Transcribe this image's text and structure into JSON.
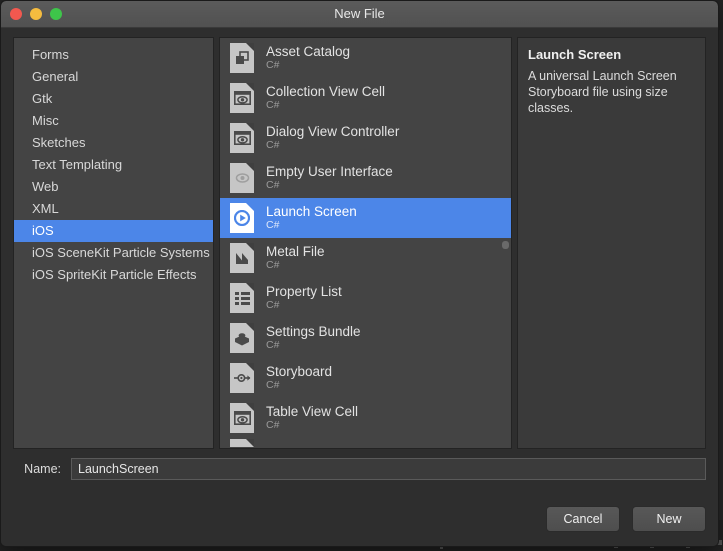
{
  "window": {
    "title": "New File",
    "traffic_lights": [
      {
        "name": "close-button",
        "color": "#f2584f"
      },
      {
        "name": "minimize-button",
        "color": "#f5bc3f"
      },
      {
        "name": "maximize-button",
        "color": "#3ec54a"
      }
    ]
  },
  "categories": {
    "selected": "iOS",
    "items": [
      {
        "label": "Forms",
        "selected": false
      },
      {
        "label": "General",
        "selected": false
      },
      {
        "label": "Gtk",
        "selected": false
      },
      {
        "label": "Misc",
        "selected": false
      },
      {
        "label": "Sketches",
        "selected": false
      },
      {
        "label": "Text Templating",
        "selected": false
      },
      {
        "label": "Web",
        "selected": false
      },
      {
        "label": "XML",
        "selected": false
      },
      {
        "label": "iOS",
        "selected": true
      },
      {
        "label": "iOS SceneKit Particle Systems",
        "selected": false
      },
      {
        "label": "iOS SpriteKit Particle Effects",
        "selected": false
      }
    ]
  },
  "templates": {
    "items": [
      {
        "name": "Asset Catalog",
        "language": "C#",
        "icon": "asset-catalog-icon",
        "selected": false
      },
      {
        "name": "Collection View Cell",
        "language": "C#",
        "icon": "collection-view-cell-icon",
        "selected": false
      },
      {
        "name": "Dialog View Controller",
        "language": "C#",
        "icon": "dialog-view-controller-icon",
        "selected": false
      },
      {
        "name": "Empty User Interface",
        "language": "C#",
        "icon": "empty-user-interface-icon",
        "selected": false
      },
      {
        "name": "Launch Screen",
        "language": "C#",
        "icon": "launch-screen-icon",
        "selected": true
      },
      {
        "name": "Metal File",
        "language": "C#",
        "icon": "metal-file-icon",
        "selected": false
      },
      {
        "name": "Property List",
        "language": "C#",
        "icon": "property-list-icon",
        "selected": false
      },
      {
        "name": "Settings Bundle",
        "language": "C#",
        "icon": "settings-bundle-icon",
        "selected": false
      },
      {
        "name": "Storyboard",
        "language": "C#",
        "icon": "storyboard-icon",
        "selected": false
      },
      {
        "name": "Table View Cell",
        "language": "C#",
        "icon": "table-view-cell-icon",
        "selected": false
      }
    ]
  },
  "details": {
    "title": "Launch Screen",
    "description": "A universal Launch Screen Storyboard file using size classes."
  },
  "name_field": {
    "label": "Name:",
    "value": "LaunchScreen",
    "placeholder": ""
  },
  "buttons": {
    "cancel": "Cancel",
    "new": "New"
  },
  "colors": {
    "accent": "#4c86e8",
    "panel": "#444444",
    "dialog": "#2e2e2e",
    "titlebar": "#565656"
  }
}
